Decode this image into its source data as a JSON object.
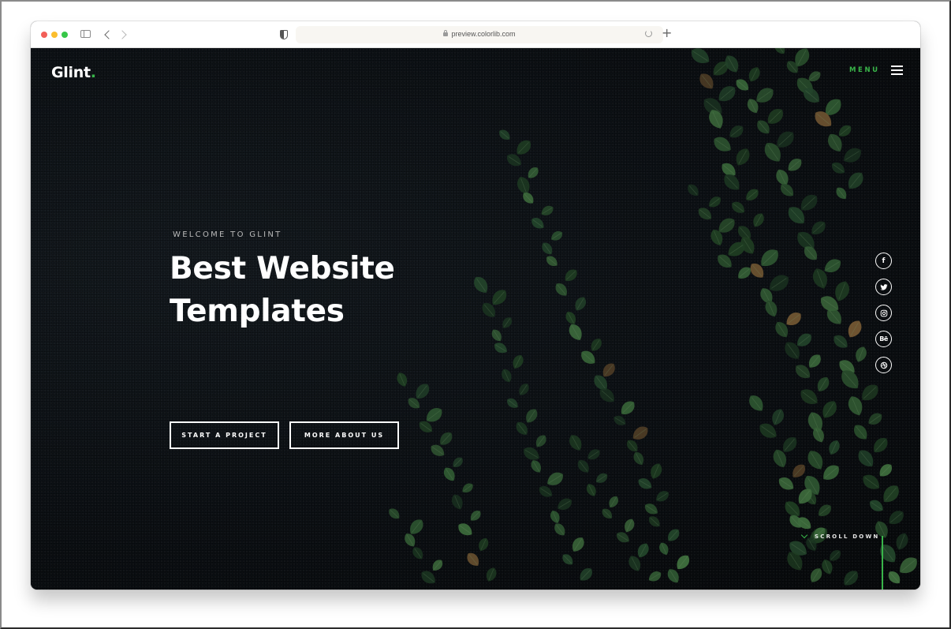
{
  "browser": {
    "url": "preview.colorlib.com",
    "icons": {
      "close": "traffic-light-red",
      "minimize": "traffic-light-yellow",
      "zoom": "traffic-light-green",
      "sidebar": "sidebar-toggle-icon",
      "back": "chevron-left-icon",
      "forward": "chevron-right-icon",
      "privacy": "shield-icon",
      "lock": "lock-icon",
      "reload": "reload-icon",
      "new_tab": "plus-icon"
    },
    "new_tab_glyph": "+"
  },
  "site": {
    "logo_text": "Glint",
    "logo_dot": ".",
    "menu_label": "MENU",
    "accent_color": "#39b54a"
  },
  "hero": {
    "eyebrow": "WELCOME TO GLINT",
    "title_line1": "Best Website",
    "title_line2": "Templates",
    "buttons": [
      {
        "label": "START A PROJECT"
      },
      {
        "label": "MORE ABOUT US"
      }
    ]
  },
  "social": [
    {
      "name": "facebook",
      "glyph": "f"
    },
    {
      "name": "twitter",
      "glyph": ""
    },
    {
      "name": "instagram",
      "glyph": ""
    },
    {
      "name": "behance",
      "glyph": "Bē"
    },
    {
      "name": "dribbble",
      "glyph": ""
    }
  ],
  "scroll": {
    "label": "SCROLL DOWN"
  }
}
